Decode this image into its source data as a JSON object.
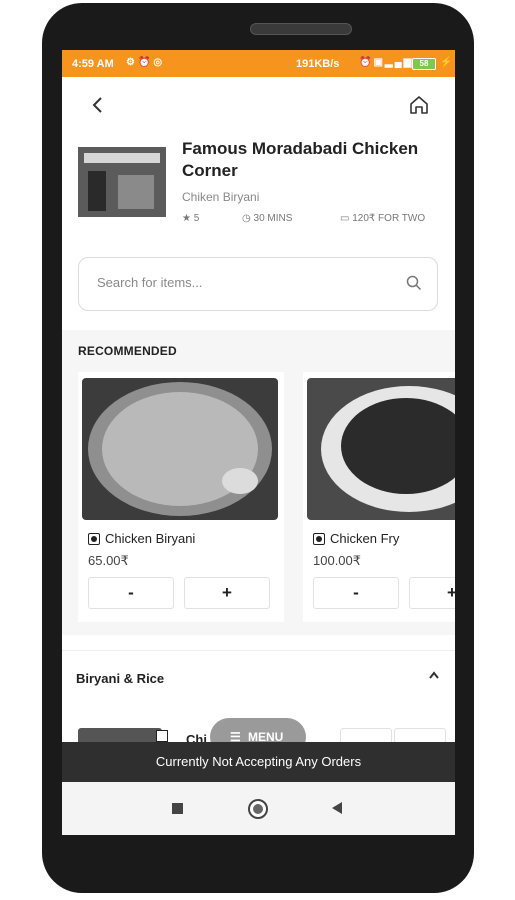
{
  "status_bar": {
    "time": "4:59 AM",
    "left_icons": [
      "settings-icon",
      "alarm-icon",
      "sync-icon"
    ],
    "network_speed": "191KB/s",
    "right_icons": [
      "alarm-icon",
      "sim-icon",
      "signal-icon"
    ],
    "battery": "58",
    "accent_color": "#f7941d"
  },
  "header": {
    "back_icon": "chevron-left-icon",
    "home_icon": "home-icon"
  },
  "restaurant": {
    "name": "Famous Moradabadi Chicken Corner",
    "cuisine": "Chiken Biryani",
    "rating": "5",
    "delivery_time": "30 MINS",
    "cost_for_two": "120₹ FOR TWO"
  },
  "search": {
    "placeholder": "Search for items..."
  },
  "recommended": {
    "label": "RECOMMENDED",
    "items": [
      {
        "name": "Chicken Biryani",
        "price": "65.00₹",
        "minus": "-",
        "plus": "+"
      },
      {
        "name": "Chicken Fry",
        "price": "100.00₹",
        "minus": "-",
        "plus": "+"
      }
    ]
  },
  "category": {
    "label": "Biryani & Rice",
    "chevron_icon": "chevron-up-icon"
  },
  "list_peek": {
    "name": "Chi"
  },
  "menu_button": {
    "label": "MENU",
    "icon": "list-icon"
  },
  "notice": {
    "text": "Currently Not Accepting Any Orders"
  },
  "nav_bar": {
    "icons": [
      "recents-icon",
      "home-icon",
      "back-icon"
    ]
  }
}
